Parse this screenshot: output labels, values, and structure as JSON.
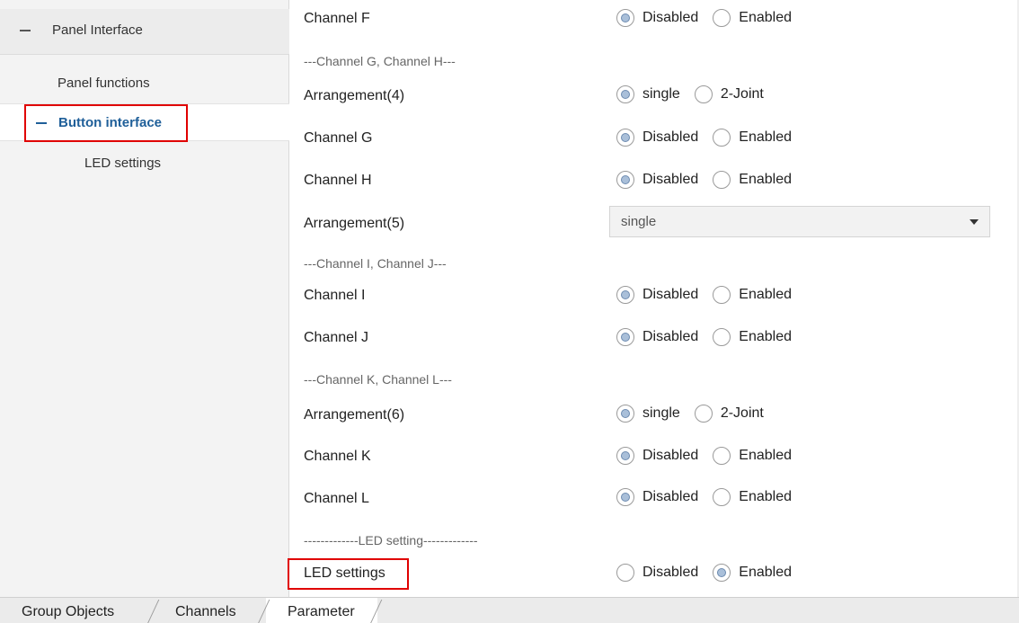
{
  "sidebar": {
    "header": "Panel Interface",
    "items": [
      {
        "label": "Panel functions"
      },
      {
        "label": "Button interface"
      },
      {
        "label": "LED settings"
      }
    ]
  },
  "main": {
    "rows": [
      {
        "label": "Channel F",
        "options": [
          "Disabled",
          "Enabled"
        ],
        "selected": 0
      },
      {
        "separator": "---Channel G, Channel H---"
      },
      {
        "label": "Arrangement(4)",
        "options": [
          "single",
          "2-Joint"
        ],
        "selected": 0
      },
      {
        "label": "Channel G",
        "options": [
          "Disabled",
          "Enabled"
        ],
        "selected": 0
      },
      {
        "label": "Channel H",
        "options": [
          "Disabled",
          "Enabled"
        ],
        "selected": 0
      },
      {
        "label": "Arrangement(5)",
        "dropdown": "single"
      },
      {
        "separator": "---Channel I, Channel J---"
      },
      {
        "label": "Channel I",
        "options": [
          "Disabled",
          "Enabled"
        ],
        "selected": 0
      },
      {
        "label": "Channel J",
        "options": [
          "Disabled",
          "Enabled"
        ],
        "selected": 0
      },
      {
        "separator": "---Channel K, Channel L---"
      },
      {
        "label": "Arrangement(6)",
        "options": [
          "single",
          "2-Joint"
        ],
        "selected": 0
      },
      {
        "label": "Channel K",
        "options": [
          "Disabled",
          "Enabled"
        ],
        "selected": 0
      },
      {
        "label": "Channel L",
        "options": [
          "Disabled",
          "Enabled"
        ],
        "selected": 0
      },
      {
        "separator": "-------------LED setting-------------"
      },
      {
        "label": "LED settings",
        "options": [
          "Disabled",
          "Enabled"
        ],
        "selected": 1
      }
    ]
  },
  "tabs": [
    "Group Objects",
    "Channels",
    "Parameter"
  ],
  "colors": {
    "accent": "#1f5f99",
    "highlight_box": "#e00000",
    "radio_fill": "#a9bfd9"
  }
}
